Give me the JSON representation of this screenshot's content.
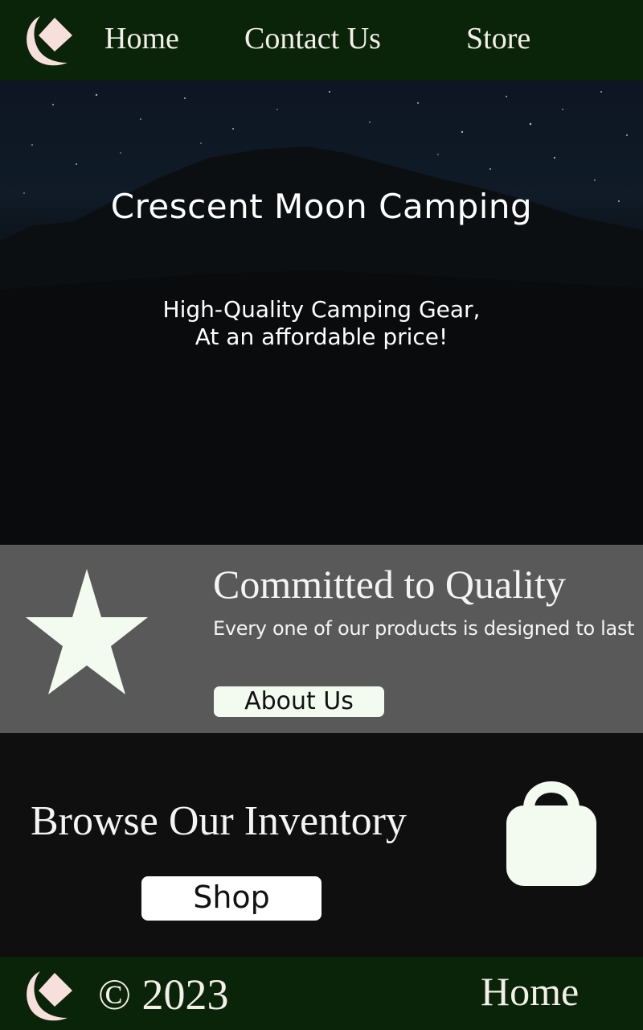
{
  "header": {
    "nav": [
      {
        "label": "Home"
      },
      {
        "label": "Contact Us"
      },
      {
        "label": "Store"
      }
    ]
  },
  "hero": {
    "title": "Crescent Moon Camping",
    "subtitle_line1": "High-Quality Camping Gear,",
    "subtitle_line2": "At an affordable price!"
  },
  "quality": {
    "icon": "star-icon",
    "title": "Committed to Quality",
    "description": "Every one of our products is designed to last",
    "button_label": "About Us"
  },
  "browse": {
    "title": "Browse Our Inventory",
    "button_label": "Shop",
    "icon": "shopping-bag-icon"
  },
  "footer": {
    "copyright": "© 2023",
    "home_label": "Home"
  },
  "colors": {
    "header_bg": "#0a2409",
    "band_gray": "#595959",
    "icon_fill": "#f3fbf0",
    "logo_fill": "#f7e0dc"
  }
}
